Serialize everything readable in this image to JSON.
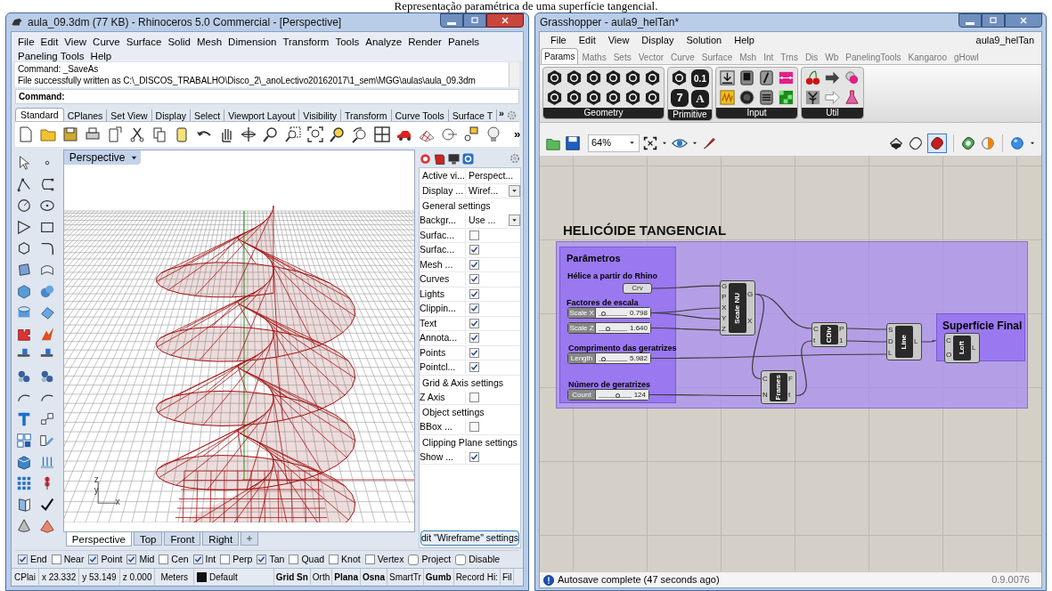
{
  "caption": "Representação paramétrica de uma superfície tangencial.",
  "rhino": {
    "title": "aula_09.3dm (77 KB) - Rhinoceros 5.0 Commercial - [Perspective]",
    "menu": [
      "File",
      "Edit",
      "View",
      "Curve",
      "Surface",
      "Solid",
      "Mesh",
      "Dimension",
      "Transform",
      "Tools",
      "Analyze",
      "Render",
      "Panels",
      "Paneling Tools",
      "Help"
    ],
    "command_history": [
      "Command: _SaveAs",
      "File successfully written as C:\\_DISCOS_TRABALHO\\Disco_2\\_anoLectivo20162017\\1_sem\\MGG\\aulas\\aula_09.3dm"
    ],
    "command_prompt": "Command:",
    "toolbar_tabs": [
      {
        "label": "Standard",
        "selected": true
      },
      {
        "label": "CPlanes",
        "selected": false
      },
      {
        "label": "Set View",
        "selected": false
      },
      {
        "label": "Display",
        "selected": false
      },
      {
        "label": "Select",
        "selected": false
      },
      {
        "label": "Viewport Layout",
        "selected": false
      },
      {
        "label": "Visibility",
        "selected": false
      },
      {
        "label": "Transform",
        "selected": false
      },
      {
        "label": "Curve Tools",
        "selected": false
      },
      {
        "label": "Surface T",
        "selected": false
      }
    ],
    "tabs_more": "»",
    "toolbar_more": "»",
    "viewport_title": "Perspective",
    "axis_labels": [
      "z",
      "y",
      "x"
    ],
    "viewport_tabs": [
      {
        "label": "Perspective",
        "selected": true
      },
      {
        "label": "Top",
        "selected": false
      },
      {
        "label": "Front",
        "selected": false
      },
      {
        "label": "Right",
        "selected": false
      }
    ],
    "properties": [
      {
        "kind": "field",
        "label": "Active vi...",
        "value": "Perspect...",
        "dropdown": false
      },
      {
        "kind": "field",
        "label": "Display ...",
        "value": "Wiref...",
        "dropdown": true
      },
      {
        "kind": "section",
        "label": "General settings"
      },
      {
        "kind": "field",
        "label": "Backgr...",
        "value": "Use ...",
        "dropdown": true
      },
      {
        "kind": "check",
        "label": "Surfac...",
        "checked": false
      },
      {
        "kind": "check",
        "label": "Surfac...",
        "checked": true
      },
      {
        "kind": "check",
        "label": "Mesh ...",
        "checked": true
      },
      {
        "kind": "check",
        "label": "Curves",
        "checked": true
      },
      {
        "kind": "check",
        "label": "Lights",
        "checked": true
      },
      {
        "kind": "check",
        "label": "Clippin...",
        "checked": true
      },
      {
        "kind": "check",
        "label": "Text",
        "checked": true
      },
      {
        "kind": "check",
        "label": "Annota...",
        "checked": true
      },
      {
        "kind": "check",
        "label": "Points",
        "checked": true
      },
      {
        "kind": "check",
        "label": "Pointcl...",
        "checked": true
      },
      {
        "kind": "section",
        "label": "Grid & Axis settings"
      },
      {
        "kind": "check",
        "label": "Z Axis",
        "checked": false
      },
      {
        "kind": "section",
        "label": "Object settings"
      },
      {
        "kind": "check",
        "label": "BBox ...",
        "checked": false
      },
      {
        "kind": "section",
        "label": "Clipping Plane settings"
      },
      {
        "kind": "check",
        "label": "Show ...",
        "checked": true
      }
    ],
    "settings_button": "dit \"Wireframe\" settings",
    "osnaps": [
      {
        "kind": "check",
        "label": "End",
        "checked": true
      },
      {
        "kind": "check",
        "label": "Near",
        "checked": false
      },
      {
        "kind": "check",
        "label": "Point",
        "checked": true
      },
      {
        "kind": "check",
        "label": "Mid",
        "checked": true
      },
      {
        "kind": "check",
        "label": "Cen",
        "checked": false
      },
      {
        "kind": "check",
        "label": "Int",
        "checked": true
      },
      {
        "kind": "check",
        "label": "Perp",
        "checked": false
      },
      {
        "kind": "check",
        "label": "Tan",
        "checked": true
      },
      {
        "kind": "check",
        "label": "Quad",
        "checked": false
      },
      {
        "kind": "check",
        "label": "Knot",
        "checked": false
      },
      {
        "kind": "check",
        "label": "Vertex",
        "checked": false
      },
      {
        "kind": "toggle",
        "label": "Project",
        "checked": false
      },
      {
        "kind": "toggle",
        "label": "Disable",
        "checked": false
      }
    ],
    "status": [
      {
        "kind": "text",
        "label": "CPlai"
      },
      {
        "kind": "text",
        "label": "x 23.332"
      },
      {
        "kind": "text",
        "label": "y 53.149"
      },
      {
        "kind": "text",
        "label": "z 0.000"
      },
      {
        "kind": "text",
        "label": "Meters"
      },
      {
        "kind": "layer",
        "label": "Default"
      },
      {
        "kind": "toggle",
        "label": "Grid Sn",
        "on": true
      },
      {
        "kind": "toggle",
        "label": "Orth",
        "on": false
      },
      {
        "kind": "toggle",
        "label": "Plana",
        "on": true
      },
      {
        "kind": "toggle",
        "label": "Osna",
        "on": true
      },
      {
        "kind": "toggle",
        "label": "SmartTr",
        "on": false
      },
      {
        "kind": "toggle",
        "label": "Gumb",
        "on": true
      },
      {
        "kind": "toggle",
        "label": "Record Hi:",
        "on": false
      },
      {
        "kind": "toggle",
        "label": "Fil",
        "on": false
      }
    ]
  },
  "grasshopper": {
    "title": "Grasshopper - aula9_helTan*",
    "menu": [
      "File",
      "Edit",
      "View",
      "Display",
      "Solution",
      "Help"
    ],
    "document": "aula9_helTan",
    "tabs": [
      {
        "label": "Params",
        "selected": true
      },
      {
        "label": "Maths",
        "selected": false
      },
      {
        "label": "Sets",
        "selected": false
      },
      {
        "label": "Vector",
        "selected": false
      },
      {
        "label": "Curve",
        "selected": false
      },
      {
        "label": "Surface",
        "selected": false
      },
      {
        "label": "Msh",
        "selected": false
      },
      {
        "label": "Int",
        "selected": false
      },
      {
        "label": "Trns",
        "selected": false
      },
      {
        "label": "Dis",
        "selected": false
      },
      {
        "label": "Wb",
        "selected": false
      },
      {
        "label": "PanelingTools",
        "selected": false
      },
      {
        "label": "Kangaroo",
        "selected": false
      },
      {
        "label": "gHowl",
        "selected": false
      }
    ],
    "panels": [
      {
        "kind": "geometry",
        "label": "Geometry"
      },
      {
        "kind": "primitive",
        "label": "Primitive",
        "glyphs": [
          "0.1",
          "7",
          "A"
        ]
      },
      {
        "kind": "input",
        "label": "Input"
      },
      {
        "kind": "util",
        "label": "Util"
      }
    ],
    "zoom": "64%",
    "canvas": {
      "title": "HELICÓIDE TANGENCIAL",
      "groups": [
        {
          "label": "Parâmetros"
        },
        {
          "label": "Superfície Final"
        }
      ],
      "labels": [
        "Hélice a partir do Rhino",
        "Factores de escala",
        "Comprimento das geratrizes",
        "Número de geratrizes"
      ],
      "nodes": [
        {
          "kind": "param",
          "name": "Crv"
        },
        {
          "kind": "slider",
          "name": "Scale X",
          "value": "0.798",
          "level": 0.2
        },
        {
          "kind": "slider",
          "name": "Scale Z",
          "value": "1.640",
          "level": 0.35
        },
        {
          "kind": "slider",
          "name": "Length",
          "value": "5.982",
          "level": 0.2
        },
        {
          "kind": "slider",
          "name": "Count",
          "value": "124",
          "level": 0.6
        },
        {
          "kind": "component",
          "name": "Scale NU",
          "inputs": [
            "G",
            "P",
            "X",
            "Y",
            "Z"
          ],
          "outputs": [
            "G",
            "X"
          ]
        },
        {
          "kind": "component",
          "name": "CDiv",
          "inputs": [
            "C",
            "t"
          ],
          "outputs": [
            "P",
            "1"
          ]
        },
        {
          "kind": "component",
          "name": "Frames",
          "inputs": [
            "C",
            "N"
          ],
          "outputs": [
            "F",
            "t"
          ]
        },
        {
          "kind": "component",
          "name": "Line",
          "inputs": [
            "S",
            "D",
            "L"
          ],
          "outputs": [
            "L"
          ]
        },
        {
          "kind": "component",
          "name": "Loft",
          "inputs": [
            "C",
            "O"
          ],
          "outputs": [
            "L"
          ]
        }
      ]
    },
    "status": "Autosave complete (47 seconds ago)",
    "version": "0.9.0076"
  }
}
